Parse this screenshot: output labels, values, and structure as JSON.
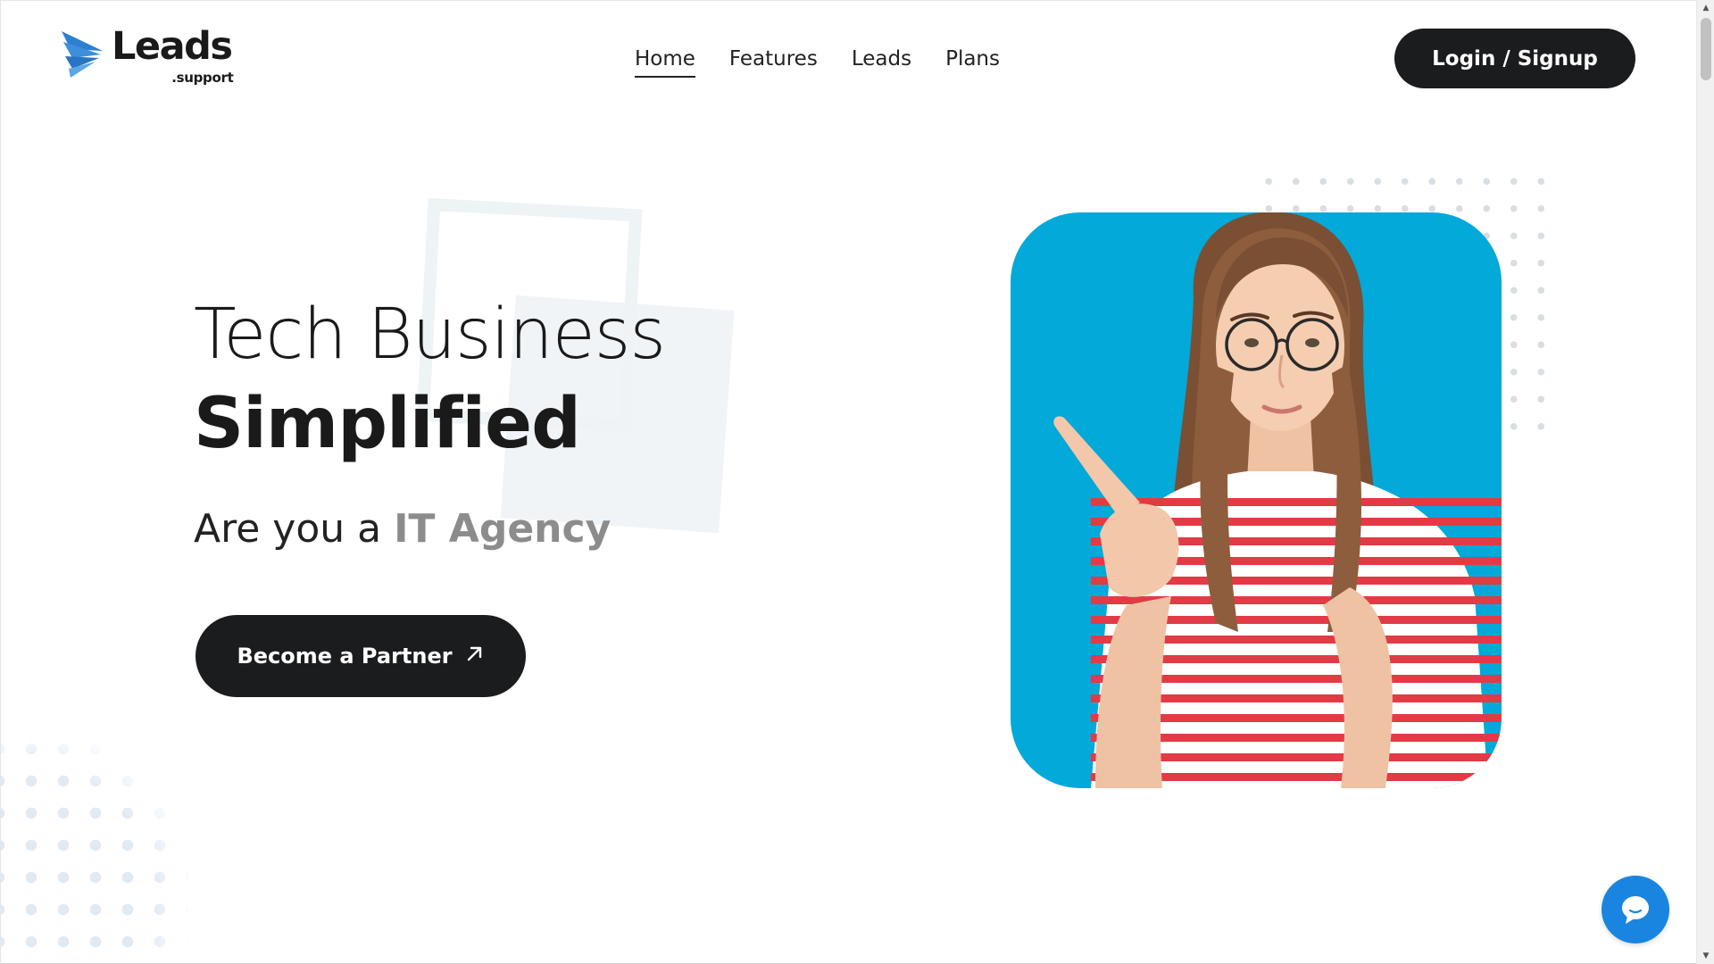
{
  "brand": {
    "name": "Leads",
    "suffix": ".support",
    "logo_icon": "paper-plane-wings-icon",
    "logo_color": "#2f7fd0"
  },
  "nav": {
    "items": [
      {
        "label": "Home",
        "active": true
      },
      {
        "label": "Features",
        "active": false
      },
      {
        "label": "Leads",
        "active": false
      },
      {
        "label": "Plans",
        "active": false
      }
    ]
  },
  "header": {
    "login_label": "Login / Signup"
  },
  "hero": {
    "title_line1": "Tech Business",
    "title_line2": "Simplified",
    "subtitle_prefix": "Are you a ",
    "subtitle_accent": "IT Agency",
    "cta_label": "Become a Partner",
    "cta_icon": "arrow-up-right-icon",
    "photo_background": "#02a9d9"
  },
  "chat": {
    "icon": "chat-bubble-icon",
    "color": "#1a85e0"
  },
  "colors": {
    "dark_button": "#1b1c1e",
    "accent_gray": "#8c8c8c"
  }
}
